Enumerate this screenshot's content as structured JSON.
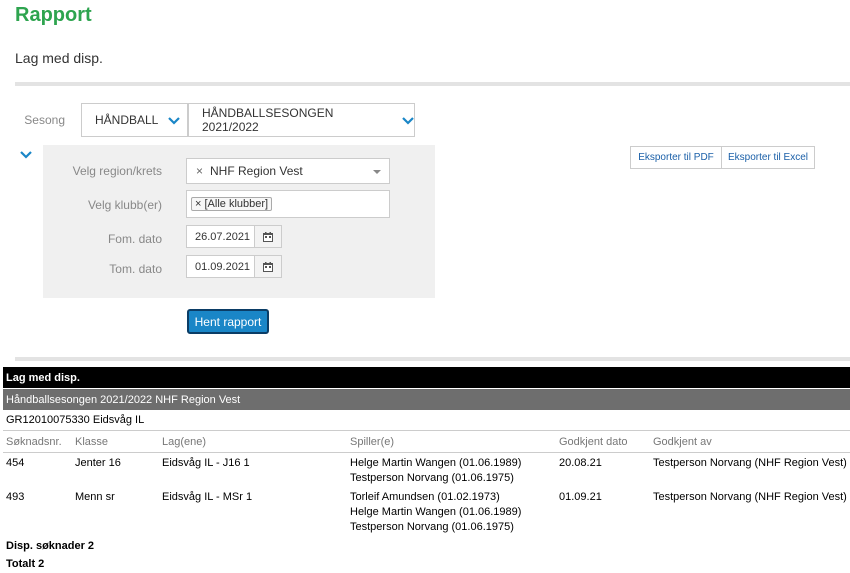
{
  "page": {
    "title": "Rapport",
    "subtitle": "Lag med disp."
  },
  "filters": {
    "season_label": "Sesong",
    "sport_value": "HÅNDBALL",
    "season_value": "HÅNDBALLSESONGEN 2021/2022",
    "region_label": "Velg region/krets",
    "region_value": "NHF Region Vest",
    "region_clear": "×",
    "club_label": "Velg klubb(er)",
    "club_tag": "[Alle klubber]",
    "club_tag_remove": "×",
    "from_label": "Fom. dato",
    "from_value": "26.07.2021",
    "to_label": "Tom. dato",
    "to_value": "01.09.2021",
    "fetch_button": "Hent rapport"
  },
  "export": {
    "pdf": "Eksporter til PDF",
    "excel": "Eksporter til Excel"
  },
  "report": {
    "heading": "Lag med disp.",
    "season_region": "Håndballsesongen 2021/2022 NHF Region Vest",
    "organization": "GR12010075330 Eidsvåg IL",
    "columns": [
      "Søknadsnr.",
      "Klasse",
      "Lag(ene)",
      "Spiller(e)",
      "Godkjent dato",
      "Godkjent av"
    ],
    "rows": [
      {
        "nr": "454",
        "klasse": "Jenter 16",
        "lag": "Eidsvåg IL - J16 1",
        "spillere": [
          "Helge Martin Wangen (01.06.1989)",
          "Testperson Norvang (01.06.1975)"
        ],
        "dato": "20.08.21",
        "godkjent_av": "Testperson Norvang (NHF Region Vest)"
      },
      {
        "nr": "493",
        "klasse": "Menn sr",
        "lag": "Eidsvåg IL - MSr 1",
        "spillere": [
          "Torleif Amundsen (01.02.1973)",
          "Helge Martin Wangen (01.06.1989)",
          "Testperson Norvang (01.06.1975)"
        ],
        "dato": "01.09.21",
        "godkjent_av": "Testperson Norvang (NHF Region Vest)"
      }
    ],
    "disp_count": "Disp. søknader 2",
    "total": "Totalt 2"
  },
  "colors": {
    "title": "#2ea44f",
    "accent": "#1a86c7"
  }
}
